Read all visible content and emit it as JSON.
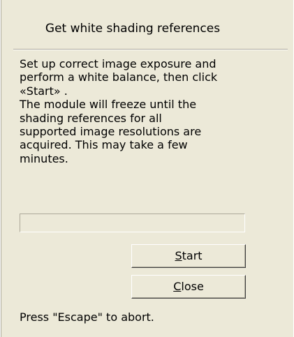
{
  "dialog": {
    "title": "Get white shading references",
    "instructions": [
      "Set up correct image exposure and",
      "perform a white balance, then click",
      "«Start» .",
      "The module will freeze until the",
      "shading references for all",
      "supported image resolutions are",
      "acquired. This may take a few",
      "minutes."
    ],
    "progress": {
      "value": 0
    },
    "buttons": {
      "start": {
        "accel": "S",
        "rest": "tart"
      },
      "close": {
        "accel": "C",
        "rest": "lose"
      }
    },
    "hint": "Press \"Escape\" to abort."
  },
  "colors": {
    "face": "#ece9d8",
    "shadow": "#aca899",
    "highlight": "#ffffff",
    "progress_fill": "#316ac5"
  }
}
